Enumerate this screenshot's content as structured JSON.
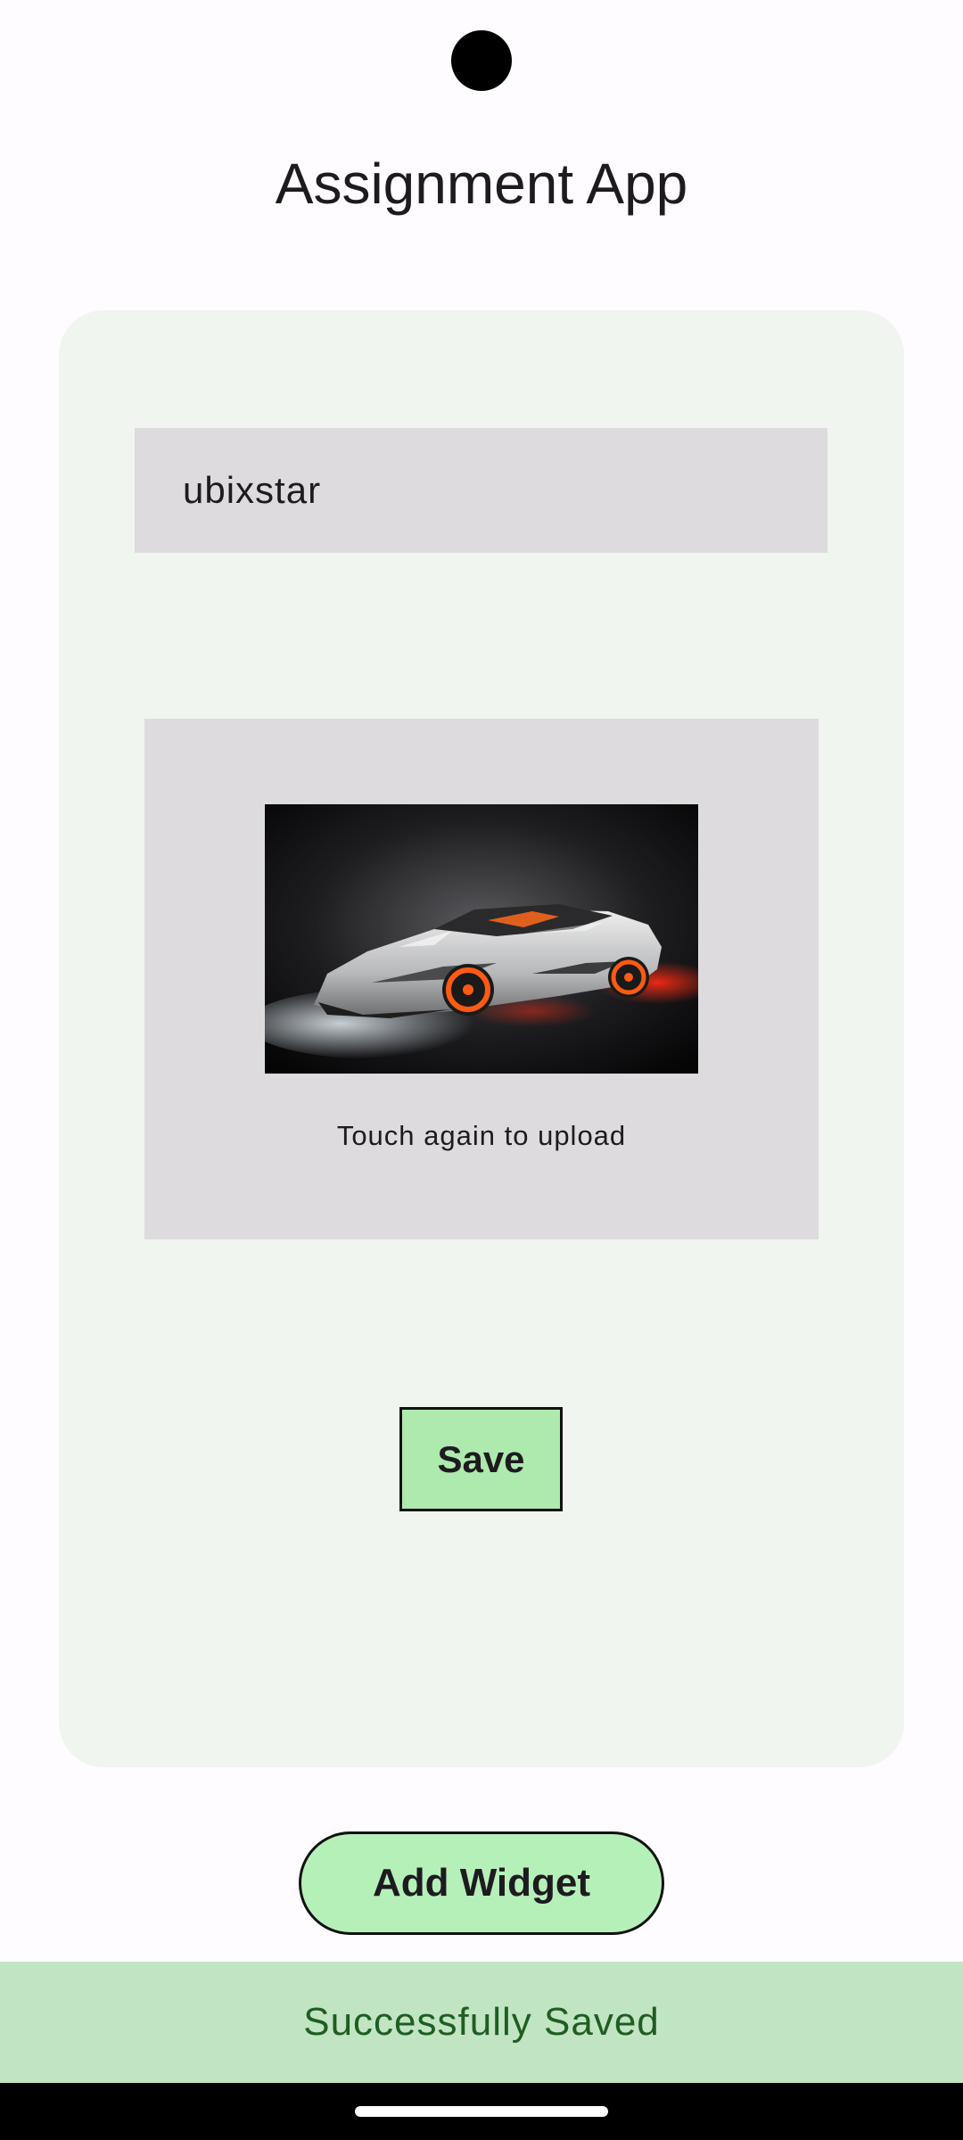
{
  "app": {
    "title": "Assignment App"
  },
  "form": {
    "text_field_value": "ubixstar",
    "upload_hint": "Touch again to upload",
    "save_label": "Save"
  },
  "actions": {
    "add_widget_label": "Add Widget"
  },
  "snackbar": {
    "message": "Successfully Saved"
  },
  "colors": {
    "card_background": "#f0f5ef",
    "field_background": "#dddbdd",
    "save_button": "#aee9ae",
    "add_widget_button": "#b6f0b9",
    "snackbar_background": "#c1e5c3",
    "snackbar_text": "#1f5e22"
  }
}
